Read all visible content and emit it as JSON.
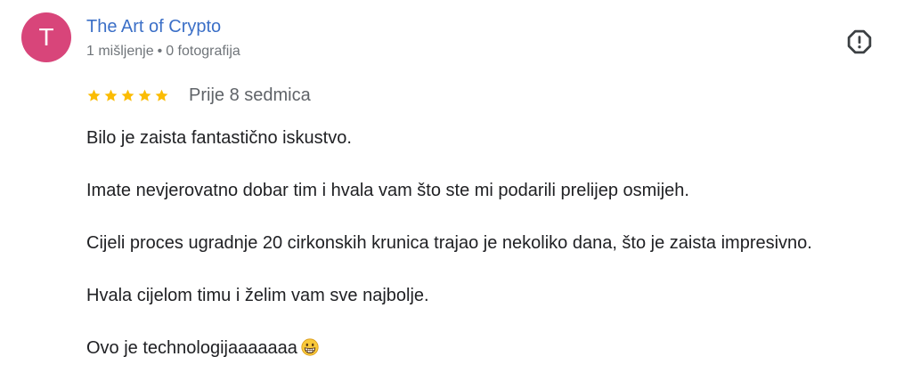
{
  "author": {
    "initial": "T",
    "name": "The Art of Crypto",
    "reviews_count": "1 mišljenje",
    "separator": "•",
    "photos_count": "0 fotografija",
    "avatar_color": "#d8457a"
  },
  "report": {
    "icon": "report-flag-icon"
  },
  "rating": {
    "stars": 5,
    "max_stars": 5,
    "star_color": "#fbbc04",
    "date": "Prije 8 sedmica"
  },
  "review": {
    "paragraphs": [
      "Bilo je zaista fantastično iskustvo.",
      "Imate nevjerovatno dobar tim i hvala vam što ste mi podarili prelijep osmijeh.",
      "Cijeli proces ugradnje 20 cirkonskih krunica trajao je nekoliko dana, što je zaista impresivno.",
      "Hvala cijelom timu i želim vam sve najbolje.",
      "Ovo je technologijaaaaaaa"
    ],
    "trailing_emoji": "grinning-face-emoji"
  }
}
